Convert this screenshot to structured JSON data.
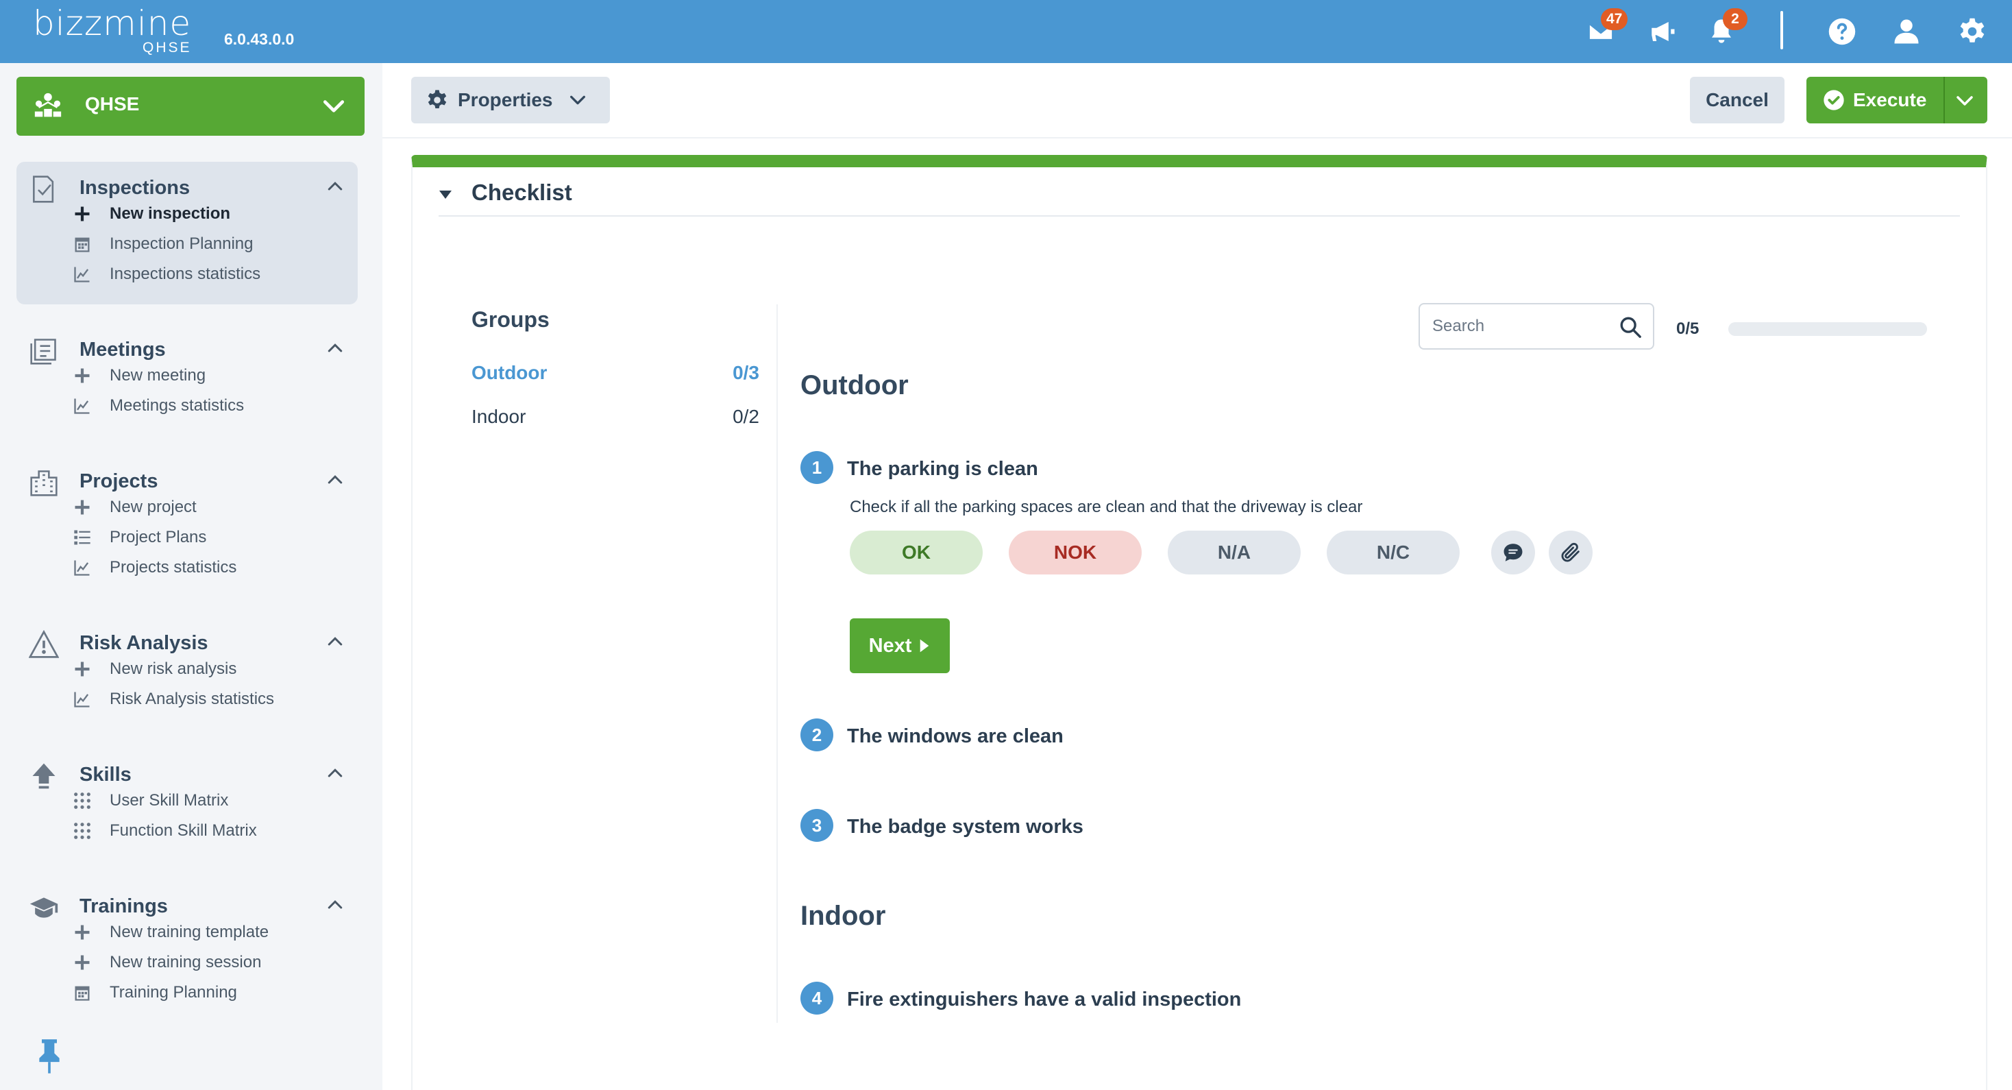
{
  "header": {
    "logo_text": "bizzmine",
    "logo_sub": "QHSE",
    "version": "6.0.43.0.0",
    "mail_count": "47",
    "notification_count": "2"
  },
  "sidebar": {
    "app_name": "QHSE",
    "sections": [
      {
        "title": "Inspections",
        "items": [
          "New inspection",
          "Inspection Planning",
          "Inspections statistics"
        ]
      },
      {
        "title": "Meetings",
        "items": [
          "New meeting",
          "Meetings statistics"
        ]
      },
      {
        "title": "Projects",
        "items": [
          "New project",
          "Project Plans",
          "Projects statistics"
        ]
      },
      {
        "title": "Risk Analysis",
        "items": [
          "New risk analysis",
          "Risk Analysis statistics"
        ]
      },
      {
        "title": "Skills",
        "items": [
          "User Skill Matrix",
          "Function Skill Matrix"
        ]
      },
      {
        "title": "Trainings",
        "items": [
          "New training template",
          "New training session",
          "Training Planning"
        ]
      }
    ]
  },
  "toolbar": {
    "properties_label": "Properties",
    "cancel_label": "Cancel",
    "execute_label": "Execute"
  },
  "checklist": {
    "title": "Checklist",
    "groups_title": "Groups",
    "groups": [
      {
        "name": "Outdoor",
        "count": "0/3"
      },
      {
        "name": "Indoor",
        "count": "0/2"
      }
    ],
    "search_placeholder": "Search",
    "progress_text": "0/5",
    "progress_fraction": 0,
    "group_headings": [
      "Outdoor",
      "Indoor"
    ],
    "questions": [
      {
        "num": "1",
        "text": "The parking is clean",
        "description": "Check if all the parking spaces are clean and that the driveway is clear"
      },
      {
        "num": "2",
        "text": "The windows are clean"
      },
      {
        "num": "3",
        "text": "The badge system works"
      },
      {
        "num": "4",
        "text": "Fire extinguishers have a valid inspection"
      }
    ],
    "answers": [
      "OK",
      "NOK",
      "N/A",
      "N/C"
    ],
    "next_label": "Next"
  }
}
